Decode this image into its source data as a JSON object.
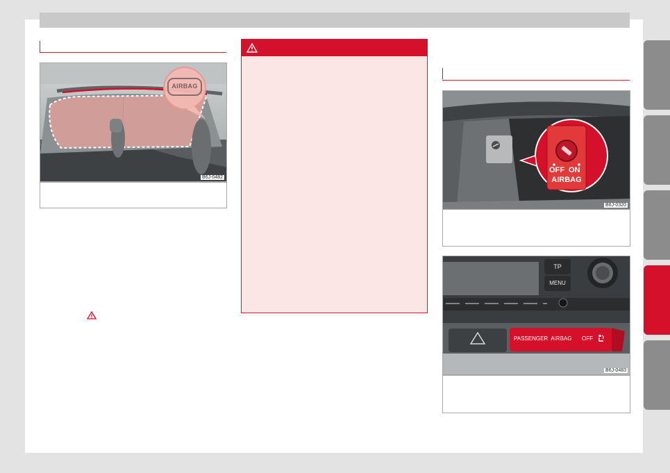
{
  "left_column": {
    "figure_code": "B6J-0482",
    "airbag_badge": "AIRBAG"
  },
  "warning_box": {
    "icon": "warning-triangle-icon"
  },
  "right_column": {
    "figure1_code": "B6J-0320",
    "switch_off": "OFF",
    "switch_on": "ON",
    "switch_label": "AIRBAG",
    "figure2_code": "B6J-0483",
    "tp_label": "TP",
    "menu_label": "MENU",
    "passenger_airbag_label": "PASSENGER  AIRBAG",
    "passenger_airbag_state": "OFF"
  },
  "colors": {
    "accent": "#d4102a",
    "warning_bg": "#fce6e3",
    "tab_inactive": "#8c8c8c"
  }
}
